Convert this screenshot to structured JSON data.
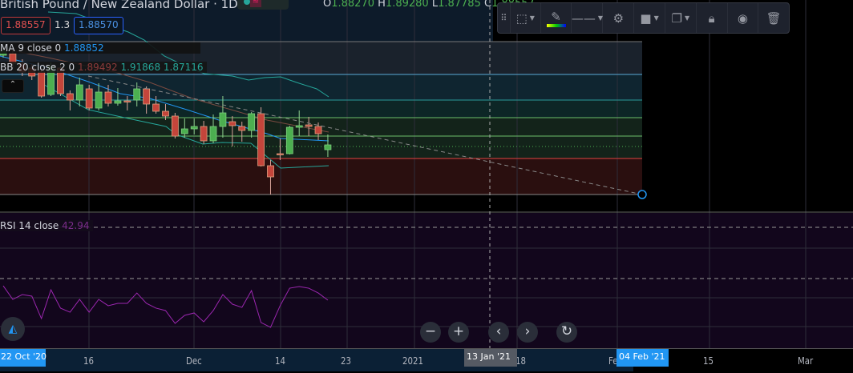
{
  "header": {
    "title": "British Pound / New Zealand Dollar · 1D · FXCM",
    "ohlc": [
      {
        "k": "O",
        "v": "1.88270"
      },
      {
        "k": "H",
        "v": "1.89280"
      },
      {
        "k": "L",
        "v": "1.87785"
      },
      {
        "k": "C",
        "v": "1.88557"
      }
    ]
  },
  "trade": {
    "sell": "1.88557",
    "spread": "1.3",
    "buy": "1.88570"
  },
  "indicators": {
    "ma": {
      "label": "MA 9 close 0",
      "value": "1.88852"
    },
    "bb": {
      "label": "BB 20 close 2 0",
      "basis": "1.89492",
      "upper": "1.91868",
      "lower": "1.87116"
    },
    "rsi": {
      "label": "RSI 14 close",
      "value": "42.94"
    }
  },
  "colors": {
    "up": "#4caf50",
    "down": "#c4453b",
    "ma": "#2196f3",
    "bb": "#26a69a",
    "basis": "#7a4a40",
    "rsi": "#9c27b0"
  },
  "toolbar": {
    "icons": [
      "drag-handle-icon",
      "selection-frame-icon",
      "pencil-color-icon",
      "line-style-icon",
      "settings-icon",
      "fill-icon",
      "clone-icon",
      "lock-icon",
      "visibility-icon",
      "trash-icon"
    ]
  },
  "time_axis": {
    "labels": [
      "16",
      "Dec",
      "14",
      "23",
      "2021",
      "18",
      "Fe",
      "15",
      "Mar"
    ],
    "start_tag": "22 Oct '20",
    "cursor_tag": "13 Jan '21",
    "end_tag": "04 Feb '21"
  },
  "candles": [
    [
      1.9193,
      1.9226,
      1.9184,
      1.9211
    ],
    [
      1.9199,
      1.9214,
      1.9145,
      1.9163
    ],
    [
      1.9163,
      1.9178,
      1.9115,
      1.913
    ],
    [
      1.9145,
      1.916,
      1.91,
      1.9115
    ],
    [
      1.913,
      1.9145,
      1.9034,
      1.904
    ],
    [
      1.9046,
      1.9166,
      1.904,
      1.9151
    ],
    [
      1.9145,
      1.916,
      1.904,
      1.9049
    ],
    [
      1.9049,
      1.9061,
      1.8986,
      1.9025
    ],
    [
      1.9025,
      1.9109,
      1.9001,
      1.9082
    ],
    [
      1.9067,
      1.9082,
      1.8986,
      1.8995
    ],
    [
      1.8995,
      1.9088,
      1.8986,
      1.9055
    ],
    [
      1.9055,
      1.9082,
      1.9001,
      1.9013
    ],
    [
      1.9013,
      1.907,
      1.9004,
      1.9022
    ],
    [
      1.9022,
      1.904,
      1.8986,
      1.902
    ],
    [
      1.9025,
      1.9091,
      1.9001,
      1.9067
    ],
    [
      1.9067,
      1.9076,
      1.8974,
      1.901
    ],
    [
      1.901,
      1.904,
      1.8974,
      1.8983
    ],
    [
      1.8983,
      1.901,
      1.895,
      1.8965
    ],
    [
      1.8965,
      1.8977,
      1.8881,
      1.889
    ],
    [
      1.8899,
      1.8956,
      1.8884,
      1.8917
    ],
    [
      1.8917,
      1.8956,
      1.8896,
      1.8926
    ],
    [
      1.8926,
      1.8947,
      1.886,
      1.8872
    ],
    [
      1.8872,
      1.8971,
      1.8863,
      1.8926
    ],
    [
      1.8926,
      1.904,
      1.8884,
      1.8977
    ],
    [
      1.8944,
      1.8965,
      1.8851,
      1.8929
    ],
    [
      1.8926,
      1.8944,
      1.8869,
      1.8911
    ],
    [
      1.8911,
      1.898,
      1.8884,
      1.8974
    ],
    [
      1.8974,
      1.8998,
      1.8776,
      1.8779
    ],
    [
      1.8779,
      1.88,
      1.8671,
      1.8737
    ],
    [
      1.8824,
      1.8881,
      1.88,
      1.8823
    ],
    [
      1.8824,
      1.8929,
      1.8821,
      1.8923
    ],
    [
      1.8923,
      1.8986,
      1.889,
      1.8929
    ],
    [
      1.8932,
      1.8962,
      1.889,
      1.8926
    ],
    [
      1.8926,
      1.8941,
      1.8875,
      1.8899
    ],
    [
      1.8839,
      1.8896,
      1.8812,
      1.8857
    ]
  ],
  "rsi_values": [
    54.9,
    43.6,
    47.6,
    46.3,
    27.6,
    51.6,
    36.3,
    32.9,
    43.6,
    32.9,
    43.6,
    38.3,
    40.3,
    40.3,
    48.9,
    40.3,
    36.3,
    34.3,
    23.6,
    30.3,
    32.3,
    24.9,
    34.3,
    47.6,
    39.6,
    36.9,
    50.9,
    24.3,
    20.3,
    38.3,
    52.9,
    54.3,
    52.9,
    48.9,
    42.94
  ]
}
